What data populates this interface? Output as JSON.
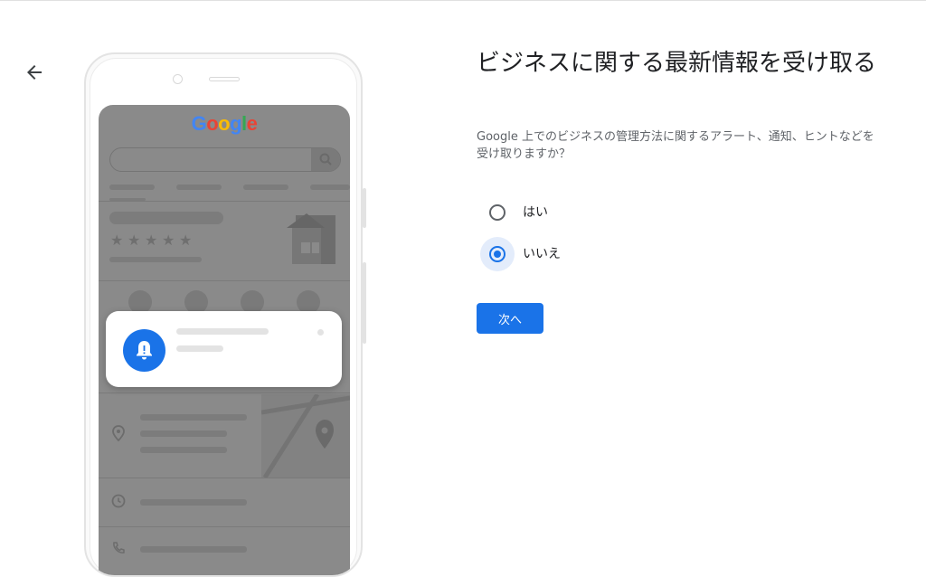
{
  "header": {
    "back_icon": "arrow-left-icon"
  },
  "illustration": {
    "brand_text": [
      "G",
      "o",
      "o",
      "g",
      "l",
      "e"
    ],
    "brand_colors": [
      "#4285f4",
      "#ea4335",
      "#fbbc05",
      "#4285f4",
      "#34a853",
      "#ea4335"
    ],
    "notification_icon": "bell-alert-icon",
    "accent": "#1a73e8"
  },
  "main": {
    "title": "ビジネスに関する最新情報を受け取る",
    "subtitle": "Google 上でのビジネスの管理方法に関するアラート、通知、ヒントなどを受け取りますか？",
    "options": [
      {
        "label": "はい",
        "selected": false
      },
      {
        "label": "いいえ",
        "selected": true
      }
    ],
    "next_button": "次へ"
  }
}
